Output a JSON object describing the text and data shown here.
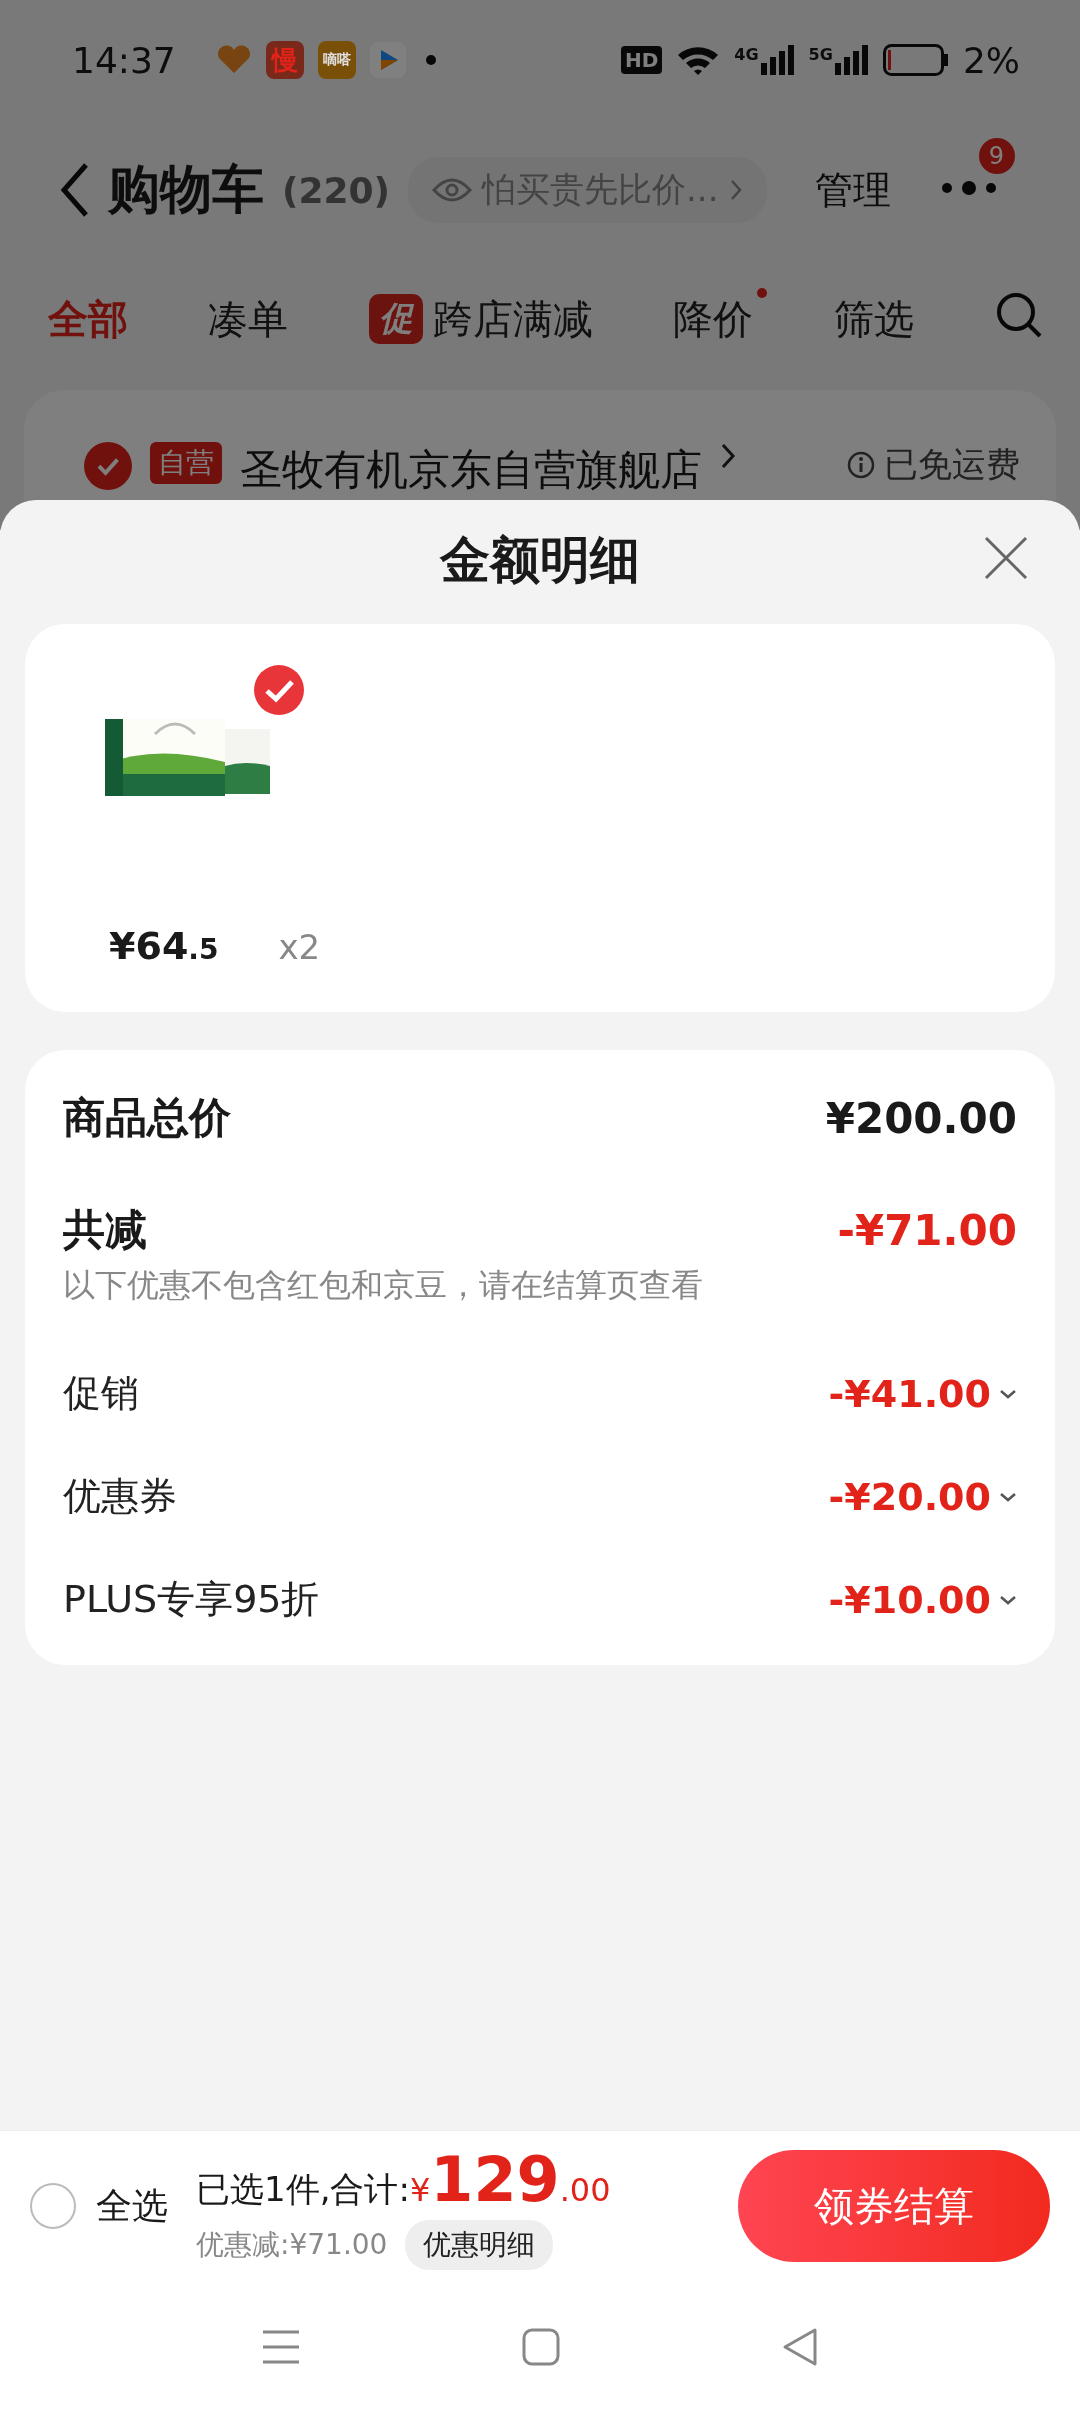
{
  "status_bar": {
    "time": "14:37",
    "notification_icons": [
      {
        "kind": "heart"
      },
      {
        "kind": "red_badge",
        "label": "慢"
      },
      {
        "kind": "orange_badge",
        "label": "嘀嗒"
      },
      {
        "kind": "play"
      }
    ],
    "hd_label": "HD",
    "networks": [
      "4G",
      "5G"
    ],
    "battery": "2%"
  },
  "header": {
    "title": "购物车",
    "count": "(220)",
    "compare_prompt": "怕买贵先比价...",
    "manage": "管理",
    "more_badge": "9"
  },
  "tabs": [
    {
      "label": "全部",
      "selected": true,
      "dot": false
    },
    {
      "label": "凑单",
      "selected": false,
      "dot": false
    },
    {
      "label": "跨店满减",
      "selected": false,
      "dot": false,
      "badge": "促"
    },
    {
      "label": "降价",
      "selected": false,
      "dot": true
    },
    {
      "label": "筛选",
      "selected": false,
      "dot": false
    }
  ],
  "store": {
    "checked": true,
    "tag": "自营",
    "name": "圣牧有机京东自营旗舰店",
    "shipping": "已免运费"
  },
  "sheet": {
    "title": "金额明细",
    "items": [
      {
        "selected": true,
        "price_main": "¥64",
        "price_decimal": ".5",
        "quantity": "x2"
      }
    ],
    "summary": {
      "total_label": "商品总价",
      "total": "¥200.00",
      "discount_label": "共减",
      "discount": "-¥71.00",
      "note": "以下优惠不包含红包和京豆，请在结算页查看",
      "rows": [
        {
          "label": "促销",
          "amount": "-¥41.00"
        },
        {
          "label": "优惠券",
          "amount": "-¥20.00"
        },
        {
          "label": "PLUS专享95折",
          "amount": "-¥10.00"
        }
      ]
    }
  },
  "footer": {
    "select_all": {
      "label": "全选",
      "checked": false
    },
    "selected_text": "已选1件,合计:",
    "currency": "¥",
    "total_int": "129",
    "total_dec": ".00",
    "saved": "优惠减:¥71.00",
    "detail_button": "优惠明细",
    "checkout": "领券结算"
  }
}
